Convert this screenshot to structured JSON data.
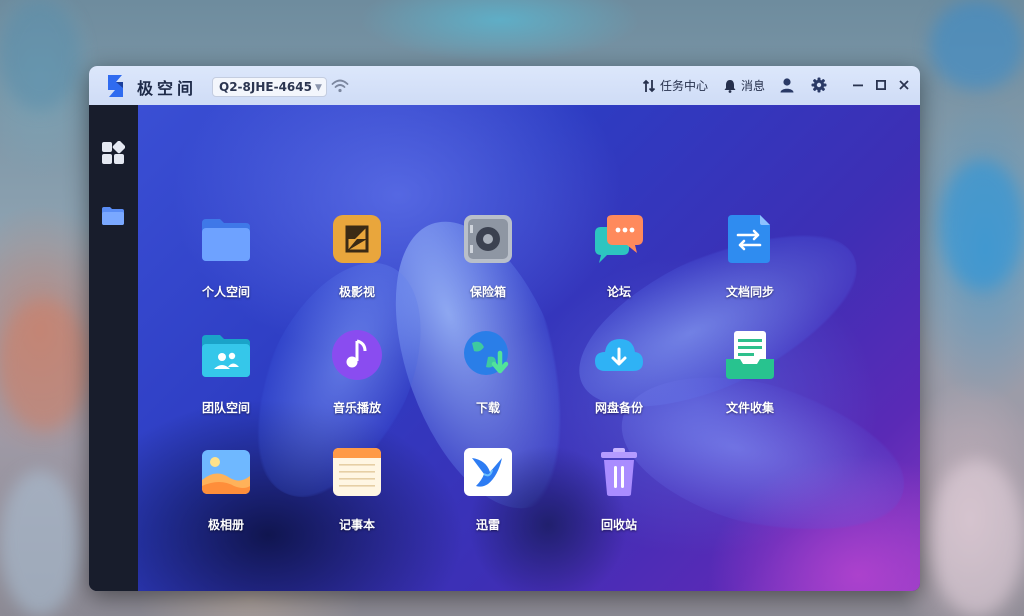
{
  "window": {
    "app_title": "极空间",
    "device_id": "Q2-8JHE-4645"
  },
  "toolbar": {
    "task_center_label": "任务中心",
    "messages_label": "消息"
  },
  "sidebar": {
    "items": [
      {
        "icon": "apps-grid-icon"
      },
      {
        "icon": "folder-icon"
      }
    ]
  },
  "desktop": {
    "apps": [
      {
        "label": "个人空间",
        "icon": "personal-folder-icon"
      },
      {
        "label": "极影视",
        "icon": "video-app-icon"
      },
      {
        "label": "保险箱",
        "icon": "safe-icon"
      },
      {
        "label": "论坛",
        "icon": "forum-chat-icon"
      },
      {
        "label": "文档同步",
        "icon": "doc-sync-icon"
      },
      {
        "label": "团队空间",
        "icon": "team-folder-icon"
      },
      {
        "label": "音乐播放",
        "icon": "music-icon"
      },
      {
        "label": "下载",
        "icon": "download-globe-icon"
      },
      {
        "label": "网盘备份",
        "icon": "cloud-backup-icon"
      },
      {
        "label": "文件收集",
        "icon": "file-collect-icon"
      },
      {
        "label": "极相册",
        "icon": "photo-album-icon"
      },
      {
        "label": "记事本",
        "icon": "notepad-icon"
      },
      {
        "label": "迅雷",
        "icon": "xunlei-bird-icon"
      },
      {
        "label": "回收站",
        "icon": "trash-icon"
      }
    ]
  },
  "colors": {
    "accent": "#3d6df2",
    "titlebar": "#d6e2f8",
    "sidebar": "#181d2c"
  }
}
